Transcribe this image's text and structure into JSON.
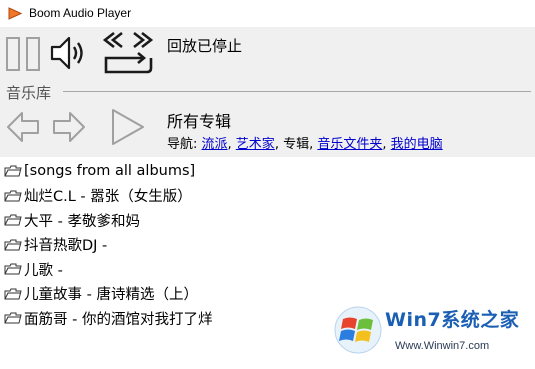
{
  "window": {
    "title": "Boom Audio Player"
  },
  "player": {
    "status": "回放已停止"
  },
  "library": {
    "label": "音乐库",
    "heading": "所有专辑",
    "nav": {
      "prefix": "导航: ",
      "genre": "流派",
      "artist": "艺术家",
      "album": "专辑",
      "music_folder": "音乐文件夹",
      "my_computer": "我的电脑",
      "separator": ", "
    }
  },
  "albums": [
    "[songs from all albums]",
    "灿烂C.L - 嚣张（女生版）",
    "大平 - 孝敬爹和妈",
    "抖音热歌DJ -",
    "儿歌 -",
    "儿童故事 - 唐诗精选（上）",
    "面筋哥 - 你的酒馆对我打了烊"
  ],
  "watermark": {
    "text": "Win7系统之家",
    "url": "Www.Winwin7.com"
  },
  "colors": {
    "panel_bg": "#f0f0f0",
    "icon_stroke": "#1a1a1a",
    "disabled_icon": "#a0a0a0",
    "link": "#0000cc"
  },
  "icons": {
    "app": "play-triangle-icon",
    "pause": "pause-icon",
    "volume": "speaker-icon",
    "repeat": "repeat-icon",
    "back": "arrow-left-icon",
    "forward": "arrow-right-icon",
    "play": "play-icon",
    "folder": "folder-icon"
  }
}
